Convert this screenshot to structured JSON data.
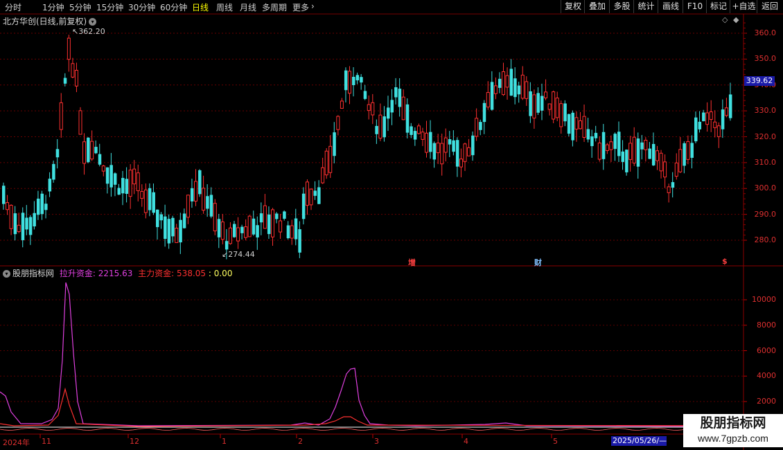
{
  "toolbar": {
    "periods": [
      "分时",
      "1分钟",
      "5分钟",
      "15分钟",
      "30分钟",
      "60分钟",
      "日线",
      "周线",
      "月线",
      "多周期",
      "更多"
    ],
    "active_period": "日线",
    "tools": [
      "复权",
      "叠加",
      "多股",
      "统计",
      "画线",
      "F10",
      "标记",
      "+自选",
      "返回"
    ]
  },
  "main_chart": {
    "title": "北方华创(日线,前复权)",
    "y_ticks": [
      "360.0",
      "350.0",
      "340.0",
      "330.0",
      "320.0",
      "310.0",
      "300.0",
      "290.0",
      "280.0"
    ],
    "current_price": "339.62",
    "high_label": "362.20",
    "low_label": "274.44",
    "events": [
      {
        "text": "增",
        "color": "#ff4040"
      },
      {
        "text": "财",
        "color": "#80c0ff"
      },
      {
        "text": "$",
        "color": "#ff4040"
      }
    ]
  },
  "indicator": {
    "name": "股朋指标网",
    "line1_label": "拉升资金:",
    "line1_value": "2215.63",
    "line2_label": "主力资金:",
    "line2_value": "538.05",
    "line3_value": ": 0.00",
    "y_ticks": [
      "10000",
      "8000",
      "6000",
      "4000",
      "2000"
    ]
  },
  "dates": {
    "labels": [
      "2024年",
      "11",
      "12",
      "1",
      "2",
      "3",
      "4",
      "5"
    ],
    "current": "2025/05/26/—"
  },
  "watermark": {
    "line1": "股朋指标网",
    "line2": "www.7gpzb.com"
  },
  "colors": {
    "up": "#ff3030",
    "down": "#40e0e0",
    "line1": "#e040e0",
    "line2": "#ff3030",
    "zero": "#ffffff",
    "axis": "#c00000"
  }
}
